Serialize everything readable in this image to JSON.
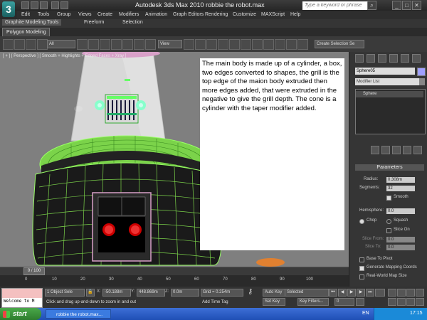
{
  "window": {
    "title": "Autodesk 3ds Max  2010      robbie the robot.max",
    "search_placeholder": "Type a keyword or phrase",
    "logo": "3"
  },
  "menu": [
    "Edit",
    "Tools",
    "Group",
    "Views",
    "Create",
    "Modifiers",
    "Animation",
    "Graph Editors",
    "Rendering",
    "Customize",
    "MAXScript",
    "Help"
  ],
  "ribbon": {
    "tabs": [
      "Graphite Modeling Tools",
      "Freeform",
      "Selection"
    ],
    "subtab": "Polygon Modeling"
  },
  "toolbar": {
    "filter_select": "All",
    "ref_coord_select": "View",
    "named_sel_select": "Create Selection Se"
  },
  "viewport": {
    "label": "[ + ] [ Perspective ] [ Smooth + Highlights + Edged Faces + Xray ]",
    "note": "The main body is made up of a cylinder, a box, two edges converted to shapes, the grill is the top edge of the maion body extruded then more edges added, that were extruded in the negative to give the grill depth.  The cone is a cylinder with the taper modifier added."
  },
  "command_panel": {
    "object_name": "Sphere05",
    "modifier_list": "Modifier List",
    "stack_item": "Sphere",
    "rollout_title": "Parameters",
    "params": {
      "radius_label": "Radius:",
      "radius_value": "0.308m",
      "segments_label": "Segments:",
      "segments_value": "32",
      "smooth_label": "Smooth",
      "hemisphere_label": "Hemisphere:",
      "hemisphere_value": "0.0",
      "chop_label": "Chop",
      "squash_label": "Squash",
      "slice_on_label": "Slice On",
      "slice_from_label": "Slice From:",
      "slice_from_value": "0.0",
      "slice_to_label": "Slice To:",
      "slice_to_value": "0.0",
      "base_to_pivot_label": "Base To Pivot",
      "gen_mapping_label": "Generate Mapping Coords",
      "real_world_label": "Real-World Map Size"
    }
  },
  "timeline": {
    "slider": "0 / 100",
    "ticks": [
      "0",
      "10",
      "20",
      "30",
      "40",
      "50",
      "60",
      "70",
      "80",
      "90",
      "100"
    ]
  },
  "status": {
    "maxscript_text": "Welcome to M",
    "selection": "1 Object Sele",
    "x_label": "X:",
    "x_value": "-50.188m",
    "y_label": "Y:",
    "y_value": "448.869m",
    "z_label": "Z:",
    "z_value": "0.0m",
    "grid": "Grid = 0.254m",
    "auto_key": "Auto Key",
    "selected": "Selected",
    "set_key": "Set Key",
    "key_filters": "Key Filters...",
    "frame": "0",
    "prompt": "Click and drag up-and-down to zoom in and out",
    "add_time_tag": "Add Time Tag"
  },
  "taskbar": {
    "start": "start",
    "task": "robbie the robot.max...",
    "language": "EN",
    "clock": "17:15"
  }
}
